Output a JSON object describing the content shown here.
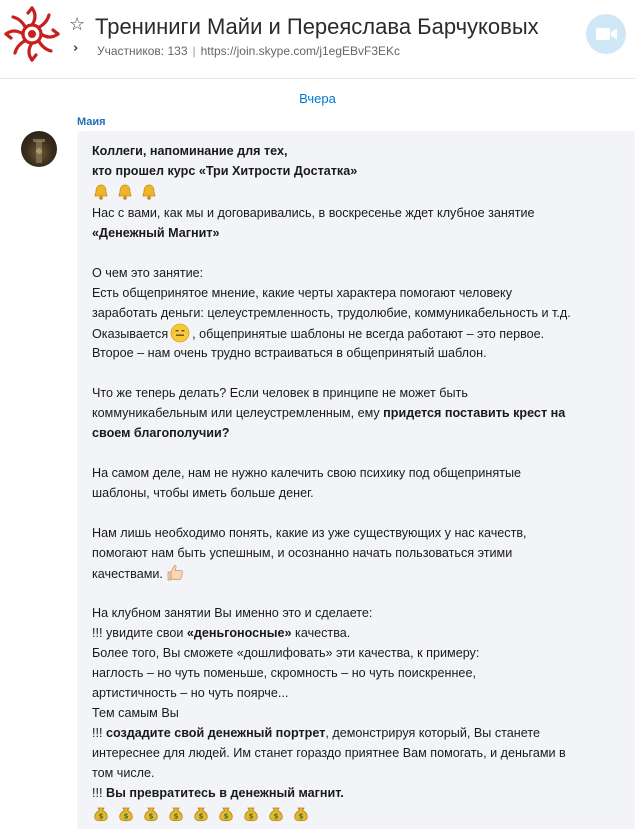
{
  "header": {
    "title": "Трениниги Майи и Переяслава Барчуковых",
    "participants": "Участников: 133",
    "separator": "|",
    "join_link": "https://join.skype.com/j1egEBvF3EKc"
  },
  "chat": {
    "day_separator": "Вчера",
    "sender": "Маия",
    "message": {
      "line1": "Коллеги, напоминание для тех,",
      "line2": "кто прошел курс  «Три Хитрости Достатка»",
      "line3": "Нас с вами, как мы и договаривались, в воскресенье ждет клубное занятие",
      "line4": "«Денежный Магнит»",
      "line5": "О чем это занятие:",
      "line6": "Есть общепринятое мнение, какие черты характера помогают человеку",
      "line7": "заработать деньги: целеустремленность, трудолюбие, коммуникабельность и т.д.",
      "line8a": "Оказывается",
      "line8b": ", общепринятые шаблоны не всегда работают – это первое.",
      "line9": "Второе – нам очень  трудно встраиваться в общепринятый шаблон.",
      "line10": "Что же теперь делать? Если человек в принципе не может быть",
      "line11a": "коммуникабельным или целеустремленным, ему  ",
      "line11b": "придется поставить крест на",
      "line12": "своем благополучии?",
      "line13": "На самом деле, нам не нужно калечить свою психику под общепринятые",
      "line14": "шаблоны, чтобы иметь больше денег.",
      "line15": "Нам лишь необходимо понять, какие из уже существующих у нас качеств,",
      "line16": "помогают нам быть успешным,  и осознанно начать пользоваться этими",
      "line17": "качествами.",
      "line18": "На клубном занятии Вы именно это и сделаете:",
      "line19a": "!!!  увидите свои ",
      "line19b": "«деньгоносные»",
      "line19c": " качества.",
      "line20": "Более того, Вы сможете «дошлифовать» эти качества, к примеру:",
      "line21": "наглость – но чуть поменьше, скромность – но чуть поискреннее,",
      "line22": "артистичность – но чуть поярче...",
      "line23": "Тем самым Вы",
      "line24a": "!!! ",
      "line24b": "создадите свой денежный портрет",
      "line24c": ", демонстрируя который,  Вы станете",
      "line25": "интереснее для людей. Им станет гораздо приятнее Вам помогать, и деньгами в",
      "line26": "том числе.",
      "line27a": "!!!  ",
      "line27b": "Вы  превратитесь в денежный магнит."
    }
  },
  "icons": {
    "star": "star-icon",
    "chevron": "chevron-right-icon",
    "video": "video-camera-icon",
    "bell": "bell-icon",
    "money": "money-bag-icon",
    "thinking": "thinking-face-icon",
    "thumbs_up": "thumbs-up-icon"
  },
  "colors": {
    "accent": "#0078d4",
    "sender": "#1f6fb8",
    "bubble": "#f2f4f7",
    "video_button": "#cfe7f7",
    "logo_red": "#c8201e"
  }
}
